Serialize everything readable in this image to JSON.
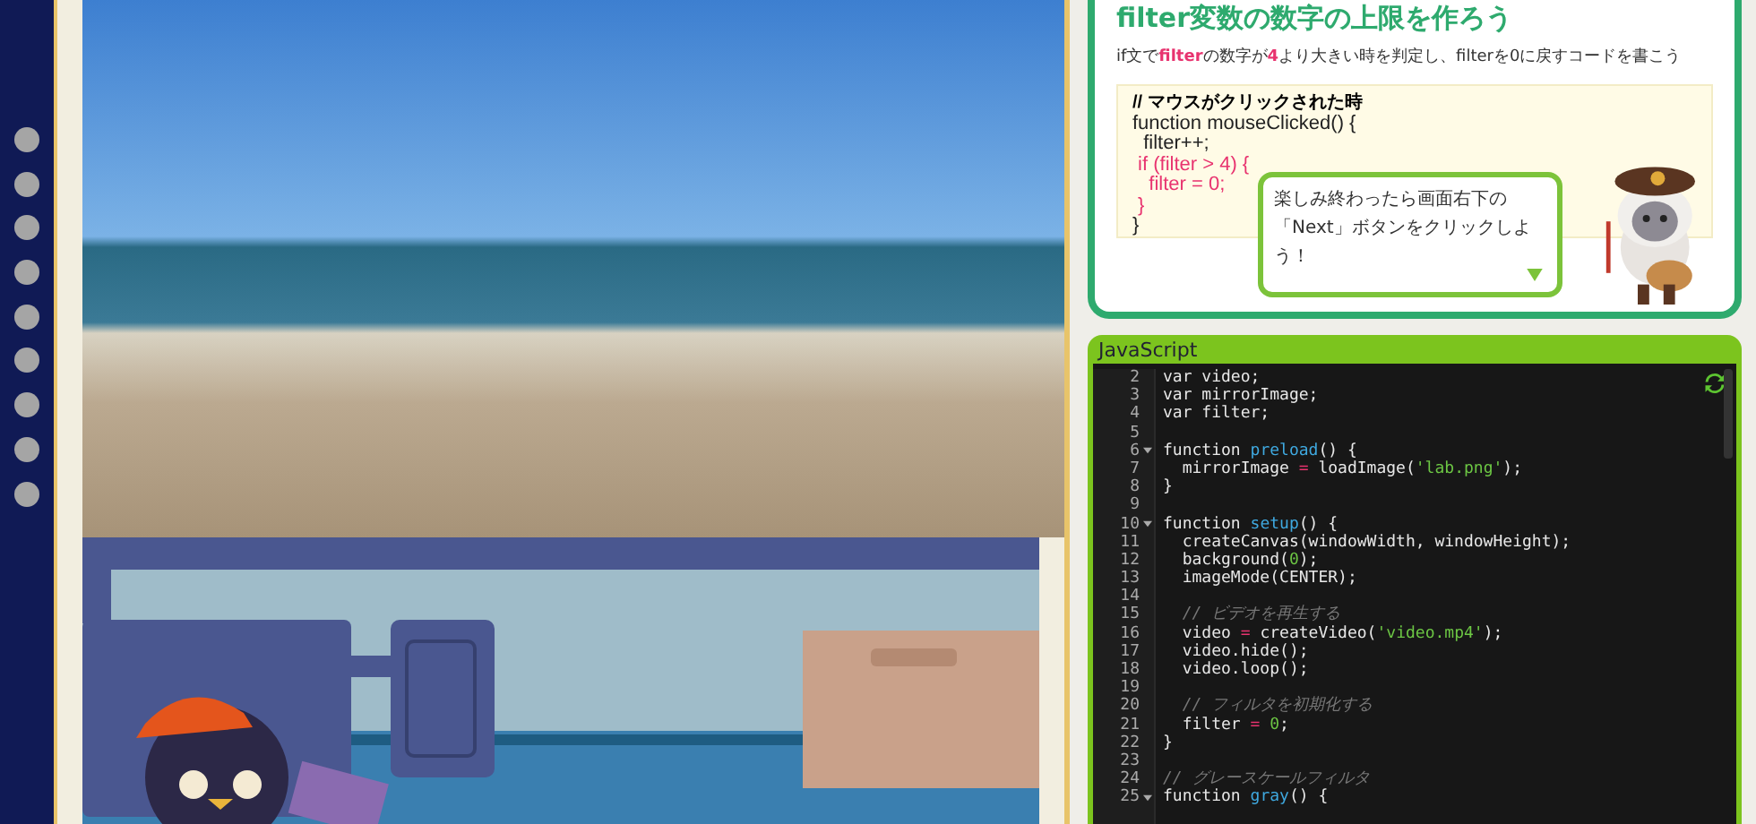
{
  "lesson": {
    "heading": "filter変数の数字の上限を作ろう",
    "instruction": "if文で**filter**の数字が**4**より大きい時を判定し、filterを0に戻すコードを書こう",
    "sample_code": [
      {
        "text": "// マウスがクリックされた時",
        "kind": "comment"
      },
      {
        "text": "function mouseClicked() {",
        "kind": "plain"
      },
      {
        "text": "  filter++;",
        "kind": "plain"
      },
      {
        "text": " if (filter > 4) {",
        "kind": "highlight"
      },
      {
        "text": "   filter = 0;",
        "kind": "highlight"
      },
      {
        "text": " }",
        "kind": "highlight"
      },
      {
        "text": "}",
        "kind": "plain"
      }
    ],
    "speech_bubble": "楽しみ終わったら画面右下の「Next」ボタンをクリックしよう！"
  },
  "editor": {
    "title": "JavaScript",
    "lines": [
      {
        "number": "2",
        "foldable": false,
        "tokens": [
          {
            "text": "var video;",
            "kind": "plain"
          }
        ]
      },
      {
        "number": "3",
        "foldable": false,
        "tokens": [
          {
            "text": "var mirrorImage;",
            "kind": "plain"
          }
        ]
      },
      {
        "number": "4",
        "foldable": false,
        "tokens": [
          {
            "text": "var filter;",
            "kind": "plain"
          }
        ]
      },
      {
        "number": "5",
        "foldable": false
      },
      {
        "number": "6",
        "foldable": true,
        "tokens": [
          {
            "text": "function ",
            "kind": "plain"
          },
          {
            "text": "preload",
            "kind": "name"
          },
          {
            "text": "() {",
            "kind": "plain"
          }
        ]
      },
      {
        "number": "7",
        "foldable": false,
        "tokens": [
          {
            "text": "  mirrorImage ",
            "kind": "plain"
          },
          {
            "text": "=",
            "kind": "op"
          },
          {
            "text": " loadImage(",
            "kind": "plain"
          },
          {
            "text": "'lab.png'",
            "kind": "string"
          },
          {
            "text": ");",
            "kind": "plain"
          }
        ]
      },
      {
        "number": "8",
        "foldable": false,
        "tokens": [
          {
            "text": "}",
            "kind": "plain"
          }
        ]
      },
      {
        "number": "9",
        "foldable": false
      },
      {
        "number": "10",
        "foldable": true,
        "tokens": [
          {
            "text": "function ",
            "kind": "plain"
          },
          {
            "text": "setup",
            "kind": "name"
          },
          {
            "text": "() {",
            "kind": "plain"
          }
        ]
      },
      {
        "number": "11",
        "foldable": false,
        "tokens": [
          {
            "text": "  createCanvas(windowWidth, windowHeight);",
            "kind": "plain"
          }
        ]
      },
      {
        "number": "12",
        "foldable": false,
        "tokens": [
          {
            "text": "  background(",
            "kind": "plain"
          },
          {
            "text": "0",
            "kind": "string"
          },
          {
            "text": ");",
            "kind": "plain"
          }
        ]
      },
      {
        "number": "13",
        "foldable": false,
        "tokens": [
          {
            "text": "  imageMode(CENTER);",
            "kind": "plain"
          }
        ]
      },
      {
        "number": "14",
        "foldable": false
      },
      {
        "number": "15",
        "foldable": false,
        "tokens": [
          {
            "text": "  // ビデオを再生する",
            "kind": "comment"
          }
        ]
      },
      {
        "number": "16",
        "foldable": false,
        "tokens": [
          {
            "text": "  video ",
            "kind": "plain"
          },
          {
            "text": "=",
            "kind": "op"
          },
          {
            "text": " createVideo(",
            "kind": "plain"
          },
          {
            "text": "'video.mp4'",
            "kind": "string"
          },
          {
            "text": ");",
            "kind": "plain"
          }
        ]
      },
      {
        "number": "17",
        "foldable": false,
        "tokens": [
          {
            "text": "  video.hide();",
            "kind": "plain"
          }
        ]
      },
      {
        "number": "18",
        "foldable": false,
        "tokens": [
          {
            "text": "  video.loop();",
            "kind": "plain"
          }
        ]
      },
      {
        "number": "19",
        "foldable": false
      },
      {
        "number": "20",
        "foldable": false,
        "tokens": [
          {
            "text": "  // フィルタを初期化する",
            "kind": "comment"
          }
        ]
      },
      {
        "number": "21",
        "foldable": false,
        "tokens": [
          {
            "text": "  filter ",
            "kind": "plain"
          },
          {
            "text": "= ",
            "kind": "op"
          },
          {
            "text": "0",
            "kind": "string"
          },
          {
            "text": ";",
            "kind": "plain"
          }
        ]
      },
      {
        "number": "22",
        "foldable": false,
        "tokens": [
          {
            "text": "}",
            "kind": "plain"
          }
        ]
      },
      {
        "number": "23",
        "foldable": false
      },
      {
        "number": "24",
        "foldable": false,
        "tokens": [
          {
            "text": "// グレースケールフィルタ",
            "kind": "comment"
          }
        ]
      },
      {
        "number": "25",
        "foldable": true,
        "tokens": [
          {
            "text": "function ",
            "kind": "plain"
          },
          {
            "text": "gray",
            "kind": "name"
          },
          {
            "text": "() {",
            "kind": "plain"
          }
        ]
      }
    ]
  }
}
